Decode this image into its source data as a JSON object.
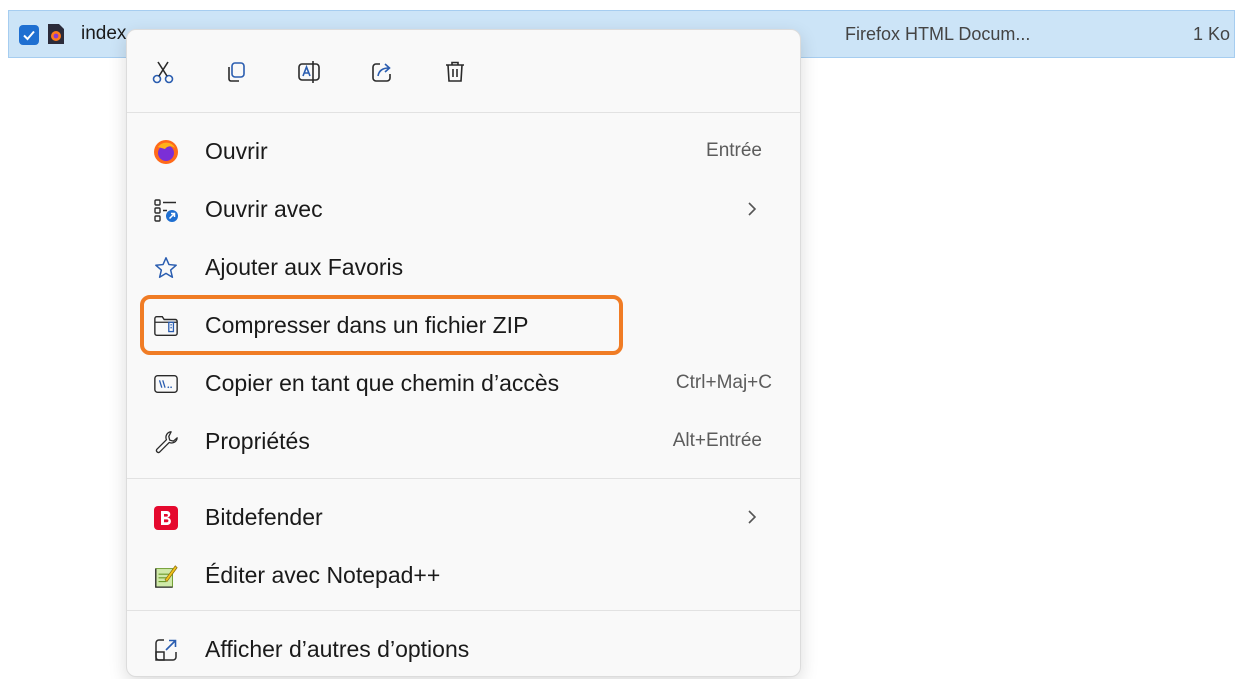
{
  "file": {
    "name": "index",
    "type": "Firefox HTML Docum...",
    "size": "1 Ko"
  },
  "toolbar": {
    "icons": [
      "cut-icon",
      "copy-icon",
      "rename-icon",
      "share-icon",
      "delete-icon"
    ]
  },
  "menu": {
    "items": [
      {
        "label": "Ouvrir",
        "shortcut": "Entrée",
        "icon": "firefox-icon"
      },
      {
        "label": "Ouvrir avec",
        "icon": "open-with-icon",
        "submenu": true
      },
      {
        "label": "Ajouter aux Favoris",
        "icon": "star-icon"
      },
      {
        "label": "Compresser dans un fichier ZIP",
        "icon": "zip-folder-icon"
      },
      {
        "label": "Copier en tant que chemin d’accès",
        "shortcut": "Ctrl+Maj+C",
        "icon": "path-icon"
      },
      {
        "label": "Propriétés",
        "shortcut": "Alt+Entrée",
        "icon": "wrench-icon"
      },
      {
        "label": "Bitdefender",
        "icon": "bitdefender-icon",
        "submenu": true
      },
      {
        "label": "Éditer avec Notepad++",
        "icon": "notepad-icon"
      },
      {
        "label": "Afficher d’autres d’options",
        "icon": "more-options-icon"
      }
    ]
  },
  "colors": {
    "selection": "#cce4f7",
    "highlight": "#f07c25",
    "accent": "#1f6fd1"
  }
}
